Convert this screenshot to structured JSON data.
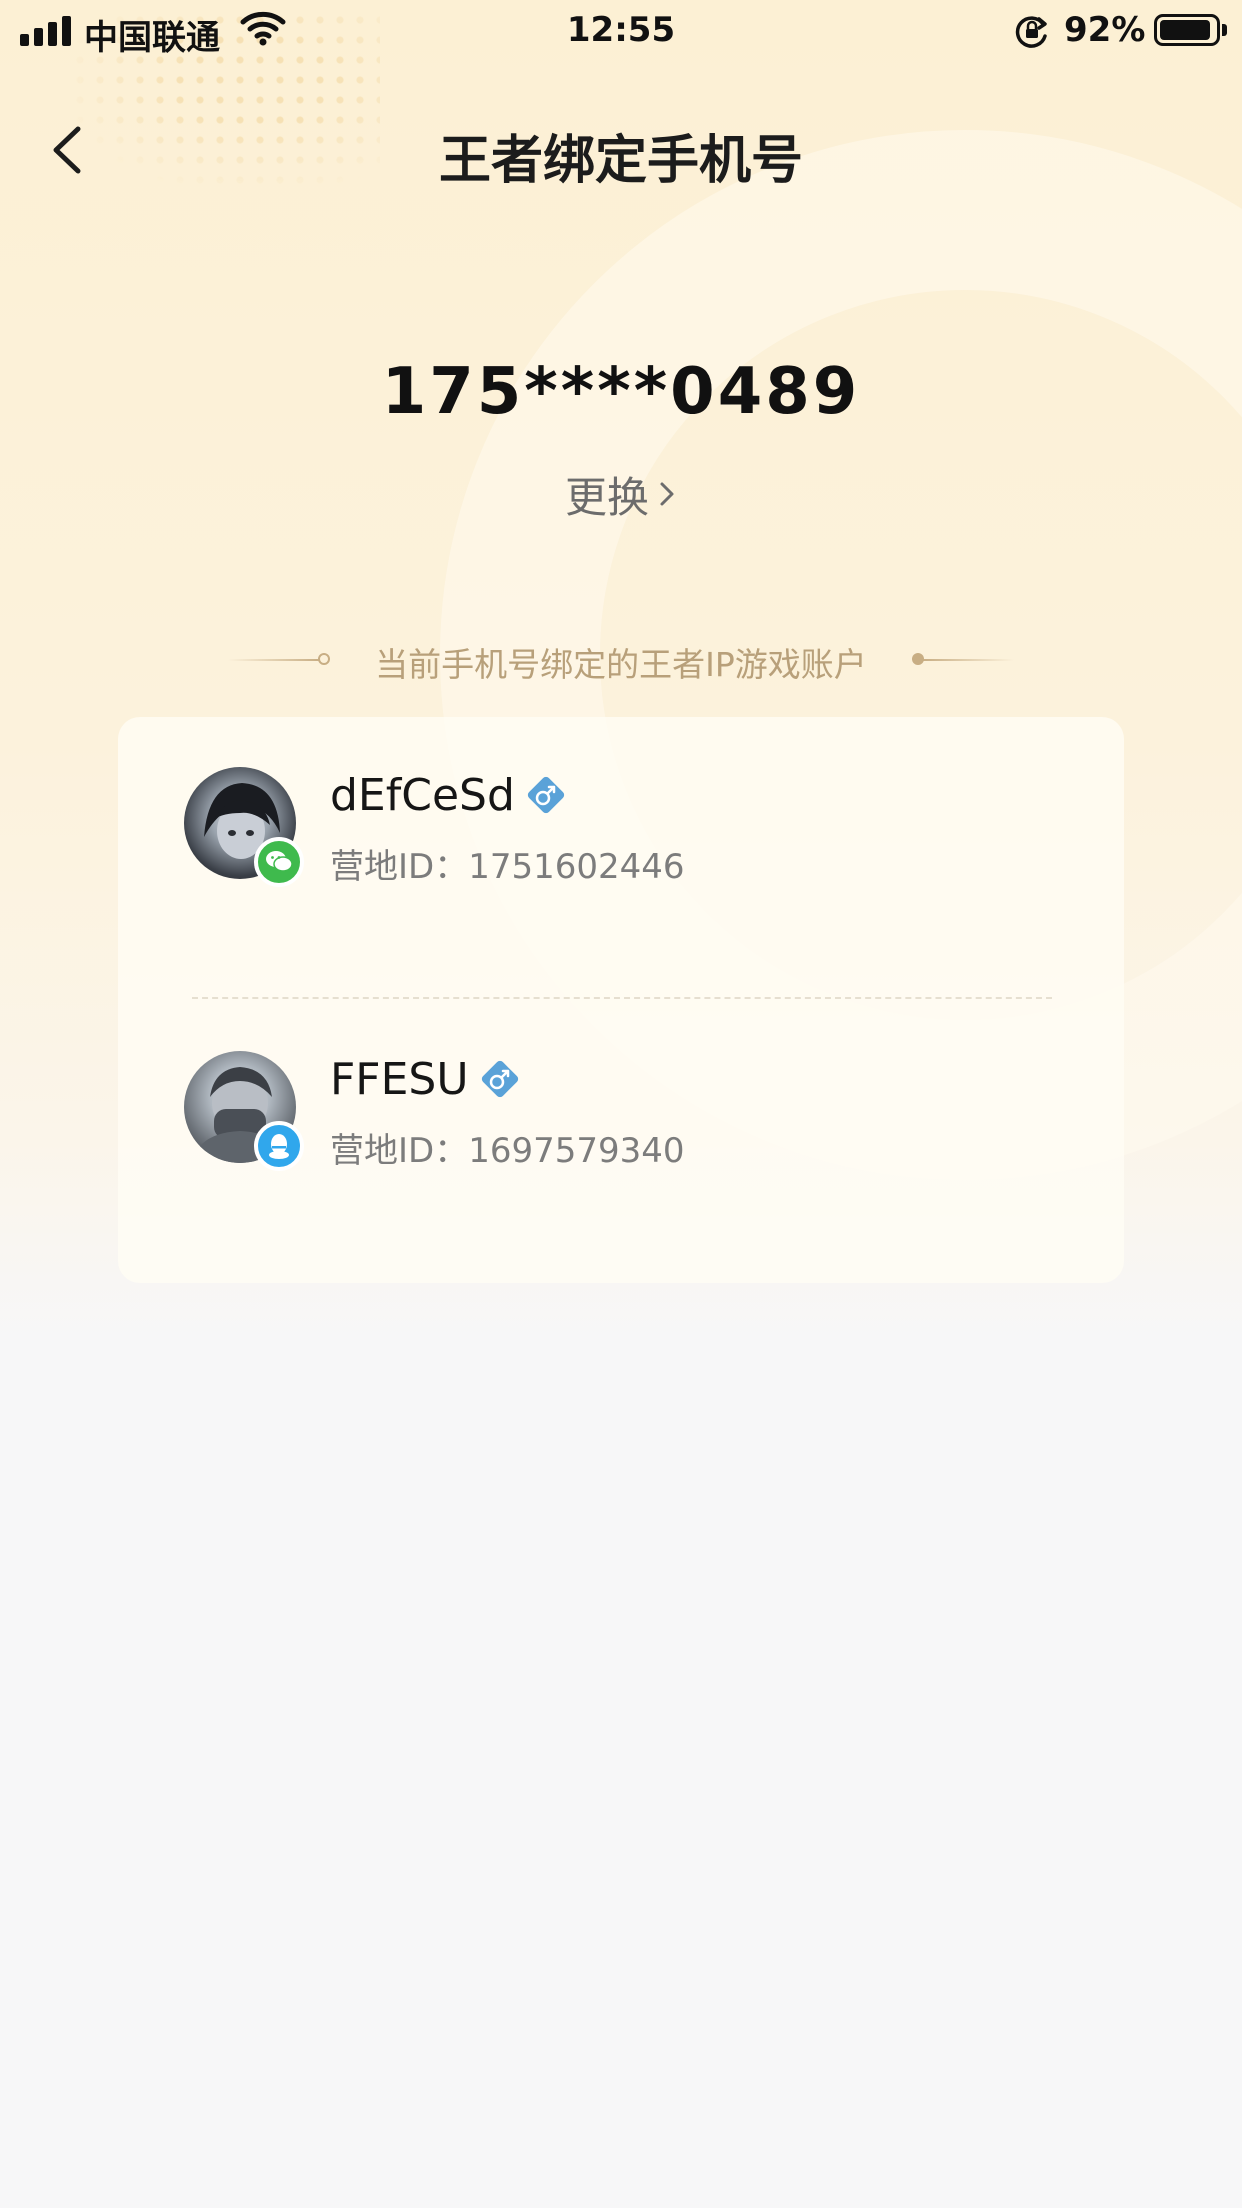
{
  "status_bar": {
    "carrier": "中国联通",
    "time": "12:55",
    "battery_percent": "92%",
    "signal_bars": 4,
    "battery_level": 0.92
  },
  "nav": {
    "title": "王者绑定手机号",
    "back_icon": "chevron-left-icon"
  },
  "phone": {
    "number": "175****0489",
    "change_label": "更换"
  },
  "section": {
    "title": "当前手机号绑定的王者IP游戏账户"
  },
  "accounts": [
    {
      "name": "dEfCeSd",
      "id_text": "营地ID：1751602446",
      "login_type": "wechat-icon",
      "gender_icon": "male-icon"
    },
    {
      "name": "FFESU",
      "id_text": "营地ID：1697579340",
      "login_type": "qq-icon",
      "gender_icon": "male-icon"
    }
  ],
  "colors": {
    "accent_bg": "#fcf0d4",
    "wechat": "#3fba4d",
    "qq": "#30a7ec",
    "gender_male": "#5aa2d8",
    "section_text": "#b8a07a"
  }
}
